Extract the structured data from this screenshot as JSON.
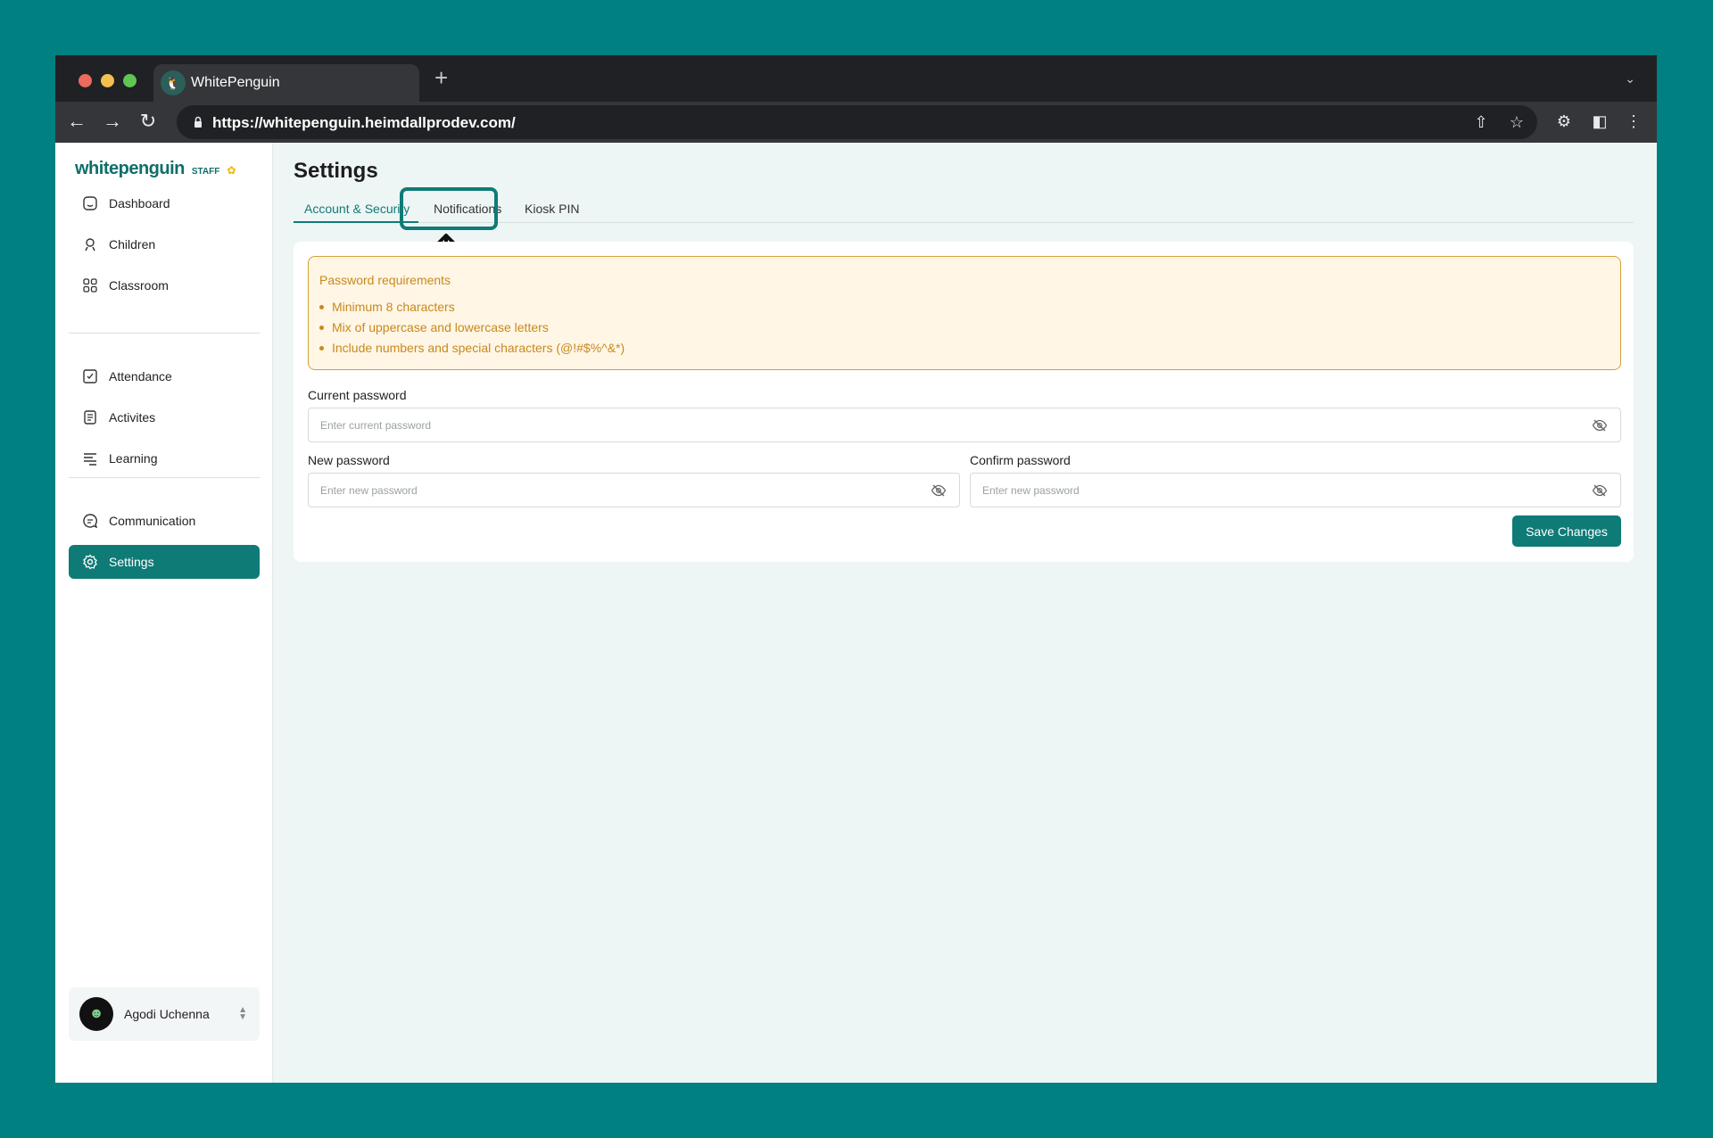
{
  "browser": {
    "tab_title": "WhitePenguin",
    "new_tab_label": "+",
    "url": "https://whitepenguin.heimdallprodev.com/"
  },
  "sidebar": {
    "brand": "whitepenguin",
    "brand_tag": "STAFF",
    "items": [
      {
        "label": "Dashboard",
        "icon": "dashboard-icon"
      },
      {
        "label": "Children",
        "icon": "children-icon"
      },
      {
        "label": "Classroom",
        "icon": "classroom-icon"
      },
      {
        "label": "Attendance",
        "icon": "attendance-icon"
      },
      {
        "label": "Activites",
        "icon": "activities-icon"
      },
      {
        "label": "Learning",
        "icon": "learning-icon"
      },
      {
        "label": "Communication",
        "icon": "communication-icon"
      },
      {
        "label": "Settings",
        "icon": "settings-icon",
        "active": true
      }
    ],
    "user": {
      "name": "Agodi Uchenna"
    }
  },
  "main": {
    "title": "Settings",
    "tabs": [
      {
        "label": "Account & Security",
        "active": true
      },
      {
        "label": "Notifications"
      },
      {
        "label": "Kiosk PIN"
      }
    ],
    "requirements": {
      "title": "Password requirements",
      "items": [
        "Minimum 8 characters",
        "Mix of uppercase and lowercase letters",
        "Include numbers and special characters (@!#$%^&*)"
      ]
    },
    "current_password": {
      "label": "Current password",
      "placeholder": "Enter current password"
    },
    "new_password": {
      "label": "New password",
      "placeholder": "Enter new password"
    },
    "confirm_password": {
      "label": "Confirm password",
      "placeholder": "Enter new password"
    },
    "save_label": "Save Changes"
  },
  "colors": {
    "background": "#008080",
    "accent": "#0f7b77",
    "warning": "#c9891b"
  }
}
